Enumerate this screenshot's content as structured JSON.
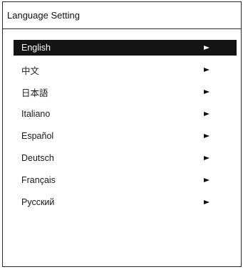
{
  "window": {
    "title": "Language Setting"
  },
  "menu": {
    "selected_index": 0,
    "items": [
      {
        "label": "English",
        "icon": "arrow-right-icon"
      },
      {
        "label": "中文",
        "icon": "arrow-right-icon"
      },
      {
        "label": "日本語",
        "icon": "arrow-right-icon"
      },
      {
        "label": "Italiano",
        "icon": "arrow-right-icon"
      },
      {
        "label": "Español",
        "icon": "arrow-right-icon"
      },
      {
        "label": "Deutsch",
        "icon": "arrow-right-icon"
      },
      {
        "label": "Français",
        "icon": "arrow-right-icon"
      },
      {
        "label": "Русский",
        "icon": "arrow-right-icon"
      }
    ]
  },
  "colors": {
    "selected_background": "#141414",
    "selected_text": "#ffffff",
    "text": "#1a1a1a",
    "border": "#2a2a2a"
  }
}
